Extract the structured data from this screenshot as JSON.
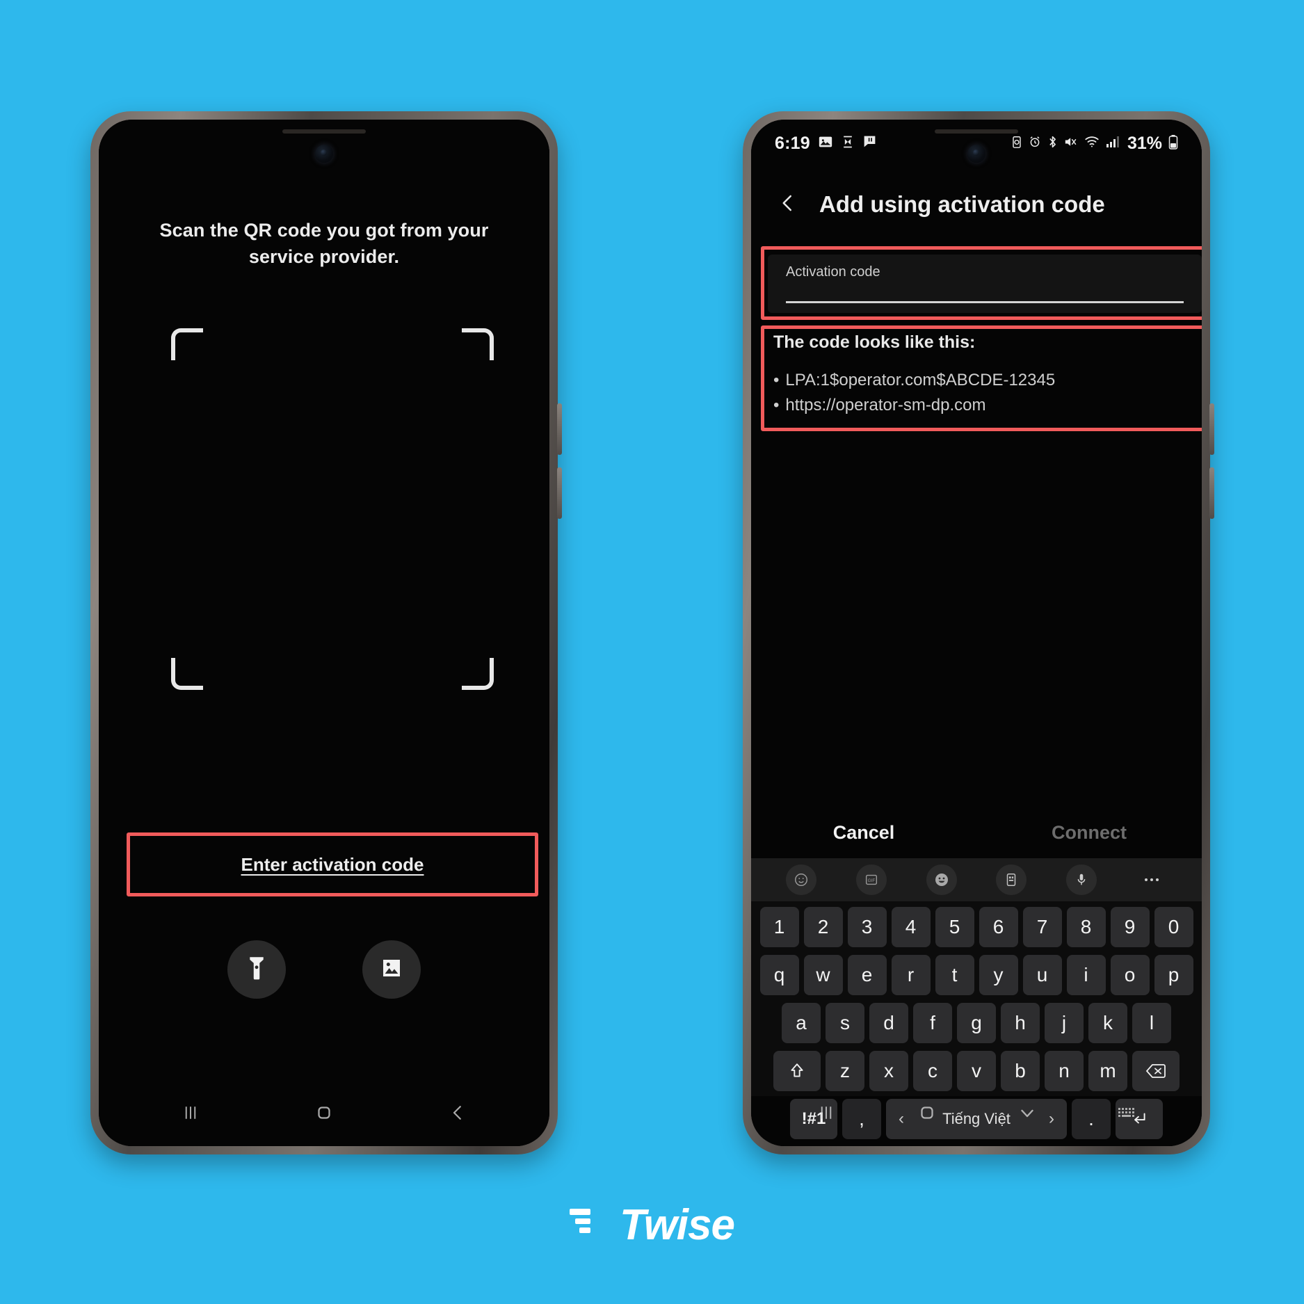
{
  "background_color": "#2eb8ec",
  "highlight_color": "#f15b5b",
  "left_phone": {
    "screen_name": "qr-scanner",
    "instruction": "Scan the QR code you got from your service provider.",
    "enter_code_link": "Enter activation code",
    "buttons": [
      {
        "name": "flashlight-button",
        "icon": "flashlight-icon"
      },
      {
        "name": "gallery-button",
        "icon": "image-icon"
      }
    ],
    "navbar": [
      {
        "name": "recents-button",
        "icon": "recents-icon"
      },
      {
        "name": "home-button",
        "icon": "home-icon"
      },
      {
        "name": "back-button",
        "icon": "back-chevron-icon"
      }
    ]
  },
  "right_phone": {
    "statusbar": {
      "time": "6:19",
      "left_icons": [
        "image-notification-icon",
        "hourglass-icon",
        "chat-icon"
      ],
      "right_icons": [
        "battery-saver-icon",
        "alarm-icon",
        "bluetooth-icon",
        "mute-icon",
        "wifi-icon",
        "signal-icon"
      ],
      "battery_percent": "31%"
    },
    "header": {
      "back_icon": "back-chevron-icon",
      "title": "Add using activation code"
    },
    "input_field": {
      "label": "Activation code",
      "value": "",
      "placeholder": ""
    },
    "code_info": {
      "title": "The code looks like this:",
      "bullet": "•",
      "examples": [
        "LPA:1$operator.com$ABCDE-12345",
        "https://operator-sm-dp.com"
      ]
    },
    "actions": {
      "cancel": "Cancel",
      "connect": "Connect"
    },
    "keyboard": {
      "toolbar_icons": [
        "sticker-icon",
        "gif-icon",
        "emoji-icon",
        "clipboard-icon",
        "microphone-icon",
        "more-options-icon"
      ],
      "rows": [
        [
          "1",
          "2",
          "3",
          "4",
          "5",
          "6",
          "7",
          "8",
          "9",
          "0"
        ],
        [
          "q",
          "w",
          "e",
          "r",
          "t",
          "y",
          "u",
          "i",
          "o",
          "p"
        ],
        [
          "a",
          "s",
          "d",
          "f",
          "g",
          "h",
          "j",
          "k",
          "l"
        ],
        [
          "z",
          "x",
          "c",
          "v",
          "b",
          "n",
          "m"
        ]
      ],
      "shift_key": "shift-icon",
      "backspace_key": "backspace-icon",
      "symbols_key": "!#1",
      "comma_key": ",",
      "period_key": ".",
      "enter_key": "enter-icon",
      "space_label": "Tiếng Việt",
      "space_prev": "‹",
      "space_next": "›"
    },
    "navbar": [
      {
        "name": "recents-button",
        "icon": "recents-icon"
      },
      {
        "name": "home-button",
        "icon": "home-icon"
      },
      {
        "name": "hide-keyboard-button",
        "icon": "chevron-down-icon"
      },
      {
        "name": "keyboard-switch-button",
        "icon": "keyboard-icon"
      }
    ]
  },
  "branding": {
    "logo_text": "Twise"
  }
}
